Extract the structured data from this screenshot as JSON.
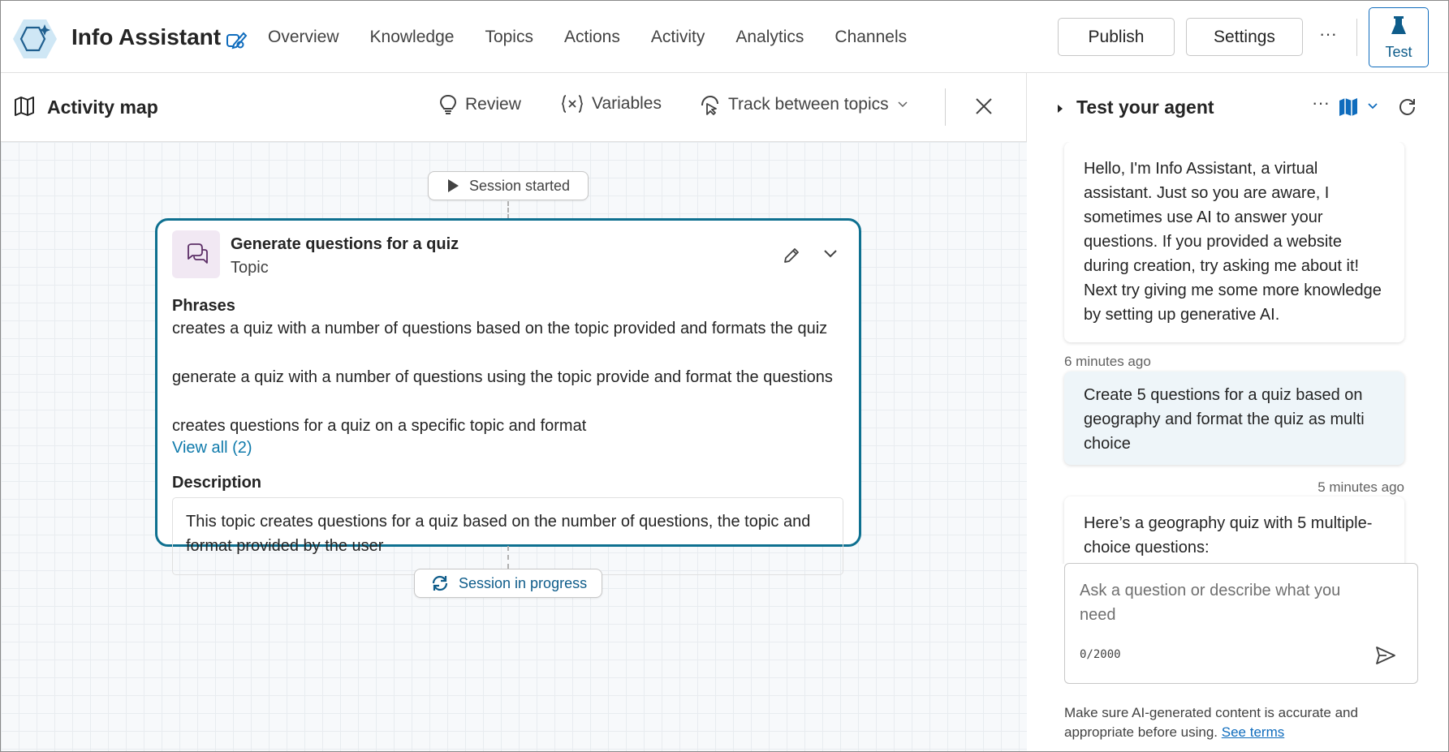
{
  "app": {
    "name": "Info Assistant",
    "icon": "agent-hexagon-icon"
  },
  "nav": {
    "items": [
      "Overview",
      "Knowledge",
      "Topics",
      "Actions",
      "Activity",
      "Analytics",
      "Channels"
    ]
  },
  "toolbar": {
    "publish_label": "Publish",
    "settings_label": "Settings",
    "more_label": "···",
    "test_label": "Test"
  },
  "activity_map": {
    "title": "Activity map",
    "review_label": "Review",
    "variables_label": "Variables",
    "track_label": "Track between topics",
    "session_started_label": "Session started",
    "session_in_progress_label": "Session in progress",
    "topic": {
      "title": "Generate questions for a quiz",
      "type": "Topic",
      "phrases_label": "Phrases",
      "phrases": [
        "creates a quiz with a number of questions based on the topic provided and formats the quiz",
        "generate a quiz with a number of questions using the topic provide and format the questions",
        "creates questions for a quiz on a specific topic and format"
      ],
      "view_all_label": "View all (2)",
      "description_label": "Description",
      "description": "This topic creates questions for a quiz based on the number of questions, the topic and format provided by the user"
    }
  },
  "test_panel": {
    "title": "Test your agent",
    "more_label": "···",
    "messages": [
      {
        "role": "bot",
        "text": "Hello, I'm Info Assistant, a virtual assistant. Just so you are aware, I sometimes use AI to answer your questions. If you provided a website during creation, try asking me about it! Next try giving me some more knowledge by setting up generative AI.",
        "timestamp": "6 minutes ago"
      },
      {
        "role": "user",
        "text": "Create 5 questions for a quiz based on geography and format the quiz as multi choice",
        "timestamp": "5 minutes ago"
      },
      {
        "role": "bot",
        "text": "Here’s a geography quiz with 5 multiple-choice questions:"
      }
    ],
    "input_placeholder": "Ask a question or describe what you need",
    "char_count": "0/2000",
    "disclaimer": "Make sure AI-generated content is accurate and appropriate before using.",
    "see_terms_label": "See terms"
  },
  "colors": {
    "accent": "#0e7090",
    "link": "#0f7aab",
    "brand_blue": "#0f6cbd"
  }
}
